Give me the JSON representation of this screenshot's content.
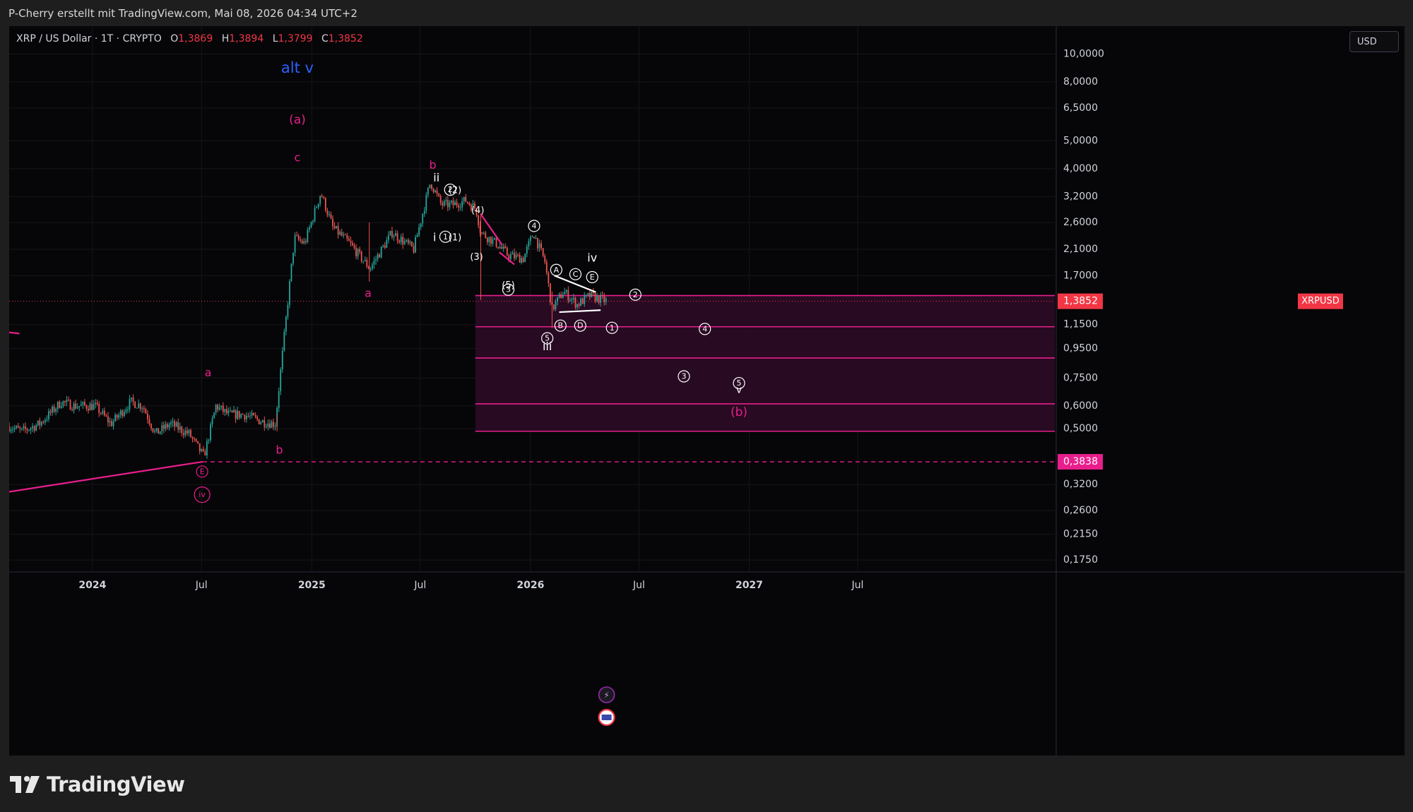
{
  "caption": "P-Cherry erstellt mit TradingView.com, Mai 08, 2026 04:34 UTC+2",
  "symbol": "XRP / US Dollar · 1T · CRYPTO",
  "ohlc": {
    "o_label": "O",
    "o": "1,3869",
    "h_label": "H",
    "h": "1,3894",
    "l_label": "L",
    "l": "1,3799",
    "c_label": "C",
    "c": "1,3852"
  },
  "currency": "USD",
  "brand": "TradingView",
  "colors": {
    "up": "#26a69a",
    "down": "#ef5350",
    "pink": "#e91e8c",
    "zone": "#2a0b24",
    "grid": "#16161a",
    "last_price": "#f23645",
    "blue": "#2962ff"
  },
  "price_badges": {
    "xrpusd_label": "XRPUSD",
    "last_price": "1,3852",
    "level_price": "0,3838"
  },
  "chart_data": {
    "type": "candlestick",
    "scale": "log",
    "ylim": [
      0.16,
      12.5
    ],
    "xlim": [
      "2023-08-15",
      "2028-05-25"
    ],
    "y_ticks": [
      {
        "v": 10.0,
        "label": "10,0000"
      },
      {
        "v": 8.0,
        "label": "8,0000"
      },
      {
        "v": 6.5,
        "label": "6,5000"
      },
      {
        "v": 5.0,
        "label": "5,0000"
      },
      {
        "v": 4.0,
        "label": "4,0000"
      },
      {
        "v": 3.2,
        "label": "3,2000"
      },
      {
        "v": 2.6,
        "label": "2,6000"
      },
      {
        "v": 2.1,
        "label": "2,1000"
      },
      {
        "v": 1.7,
        "label": "1,7000"
      },
      {
        "v": 1.15,
        "label": "1,1500"
      },
      {
        "v": 0.95,
        "label": "0,9500"
      },
      {
        "v": 0.75,
        "label": "0,7500"
      },
      {
        "v": 0.6,
        "label": "0,6000"
      },
      {
        "v": 0.5,
        "label": "0,5000"
      },
      {
        "v": 0.32,
        "label": "0,3200"
      },
      {
        "v": 0.26,
        "label": "0,2600"
      },
      {
        "v": 0.215,
        "label": "0,2150"
      },
      {
        "v": 0.175,
        "label": "0,1750"
      }
    ],
    "x_ticks": [
      {
        "d": "2024-01-01",
        "label": "2024",
        "bold": true
      },
      {
        "d": "2024-07-01",
        "label": "Jul",
        "bold": false
      },
      {
        "d": "2025-01-01",
        "label": "2025",
        "bold": true
      },
      {
        "d": "2025-07-01",
        "label": "Jul",
        "bold": false
      },
      {
        "d": "2026-01-01",
        "label": "2026",
        "bold": true
      },
      {
        "d": "2026-07-01",
        "label": "Jul",
        "bold": false
      },
      {
        "d": "2027-01-01",
        "label": "2027",
        "bold": true
      },
      {
        "d": "2027-07-01",
        "label": "Jul",
        "bold": false
      }
    ],
    "price_path": [
      [
        "2023-08-15",
        0.51
      ],
      [
        "2023-09-05",
        0.49
      ],
      [
        "2023-10-05",
        0.52
      ],
      [
        "2023-11-10",
        0.62
      ],
      [
        "2023-12-01",
        0.6
      ],
      [
        "2024-01-05",
        0.6
      ],
      [
        "2024-02-01",
        0.52
      ],
      [
        "2024-03-05",
        0.62
      ],
      [
        "2024-03-25",
        0.6
      ],
      [
        "2024-04-15",
        0.48
      ],
      [
        "2024-05-10",
        0.52
      ],
      [
        "2024-06-10",
        0.48
      ],
      [
        "2024-07-05",
        0.4
      ],
      [
        "2024-07-25",
        0.6
      ],
      [
        "2024-08-15",
        0.56
      ],
      [
        "2024-09-10",
        0.56
      ],
      [
        "2024-10-10",
        0.53
      ],
      [
        "2024-11-01",
        0.52
      ],
      [
        "2024-11-15",
        1.0
      ],
      [
        "2024-12-03",
        2.3
      ],
      [
        "2024-12-20",
        2.2
      ],
      [
        "2025-01-16",
        3.3
      ],
      [
        "2025-02-05",
        2.5
      ],
      [
        "2025-03-05",
        2.2
      ],
      [
        "2025-04-08",
        1.8
      ],
      [
        "2025-05-15",
        2.4
      ],
      [
        "2025-06-20",
        2.1
      ],
      [
        "2025-07-18",
        3.6
      ],
      [
        "2025-08-05",
        3.0
      ],
      [
        "2025-08-25",
        3.0
      ],
      [
        "2025-09-15",
        3.1
      ],
      [
        "2025-10-02",
        2.9
      ],
      [
        "2025-10-10",
        2.4
      ],
      [
        "2025-11-05",
        2.2
      ],
      [
        "2025-11-25",
        2.0
      ],
      [
        "2025-12-20",
        1.95
      ],
      [
        "2026-01-06",
        2.4
      ],
      [
        "2026-01-25",
        1.9
      ],
      [
        "2026-02-06",
        1.3
      ],
      [
        "2026-02-25",
        1.5
      ],
      [
        "2026-03-20",
        1.35
      ],
      [
        "2026-04-10",
        1.45
      ],
      [
        "2026-05-08",
        1.3852
      ]
    ],
    "zones": [
      {
        "from": "2025-10-01",
        "to": "2028-05-25",
        "top": 1.45,
        "bottom": 0.49
      }
    ],
    "levels": [
      1.45,
      1.13,
      0.88,
      0.61,
      0.49
    ],
    "dashed_level": 0.3838,
    "last_price": 1.3852
  },
  "labels": [
    {
      "text": "alt v",
      "d": "2024-12-08",
      "v": 8.9,
      "color": "#2962ff",
      "size": 21
    },
    {
      "text": "(a)",
      "d": "2024-12-08",
      "v": 5.9,
      "color": "#e91e8c",
      "size": 17
    },
    {
      "text": "c",
      "d": "2024-12-08",
      "v": 4.35,
      "color": "#e91e8c",
      "size": 16
    },
    {
      "text": "b",
      "d": "2025-07-22",
      "v": 4.1,
      "color": "#e91e8c",
      "size": 16
    },
    {
      "text": "ii",
      "d": "2025-07-28",
      "v": 3.7,
      "color": "#ffffff",
      "size": 16
    },
    {
      "text": "i",
      "d": "2025-07-25",
      "v": 2.3,
      "color": "#ffffff",
      "size": 16
    },
    {
      "text": "a",
      "d": "2025-04-05",
      "v": 1.47,
      "color": "#e91e8c",
      "size": 16
    },
    {
      "text": "a",
      "d": "2024-07-12",
      "v": 0.78,
      "color": "#e91e8c",
      "size": 16
    },
    {
      "text": "b",
      "d": "2024-11-08",
      "v": 0.42,
      "color": "#e91e8c",
      "size": 16
    },
    {
      "text": "(2)",
      "d": "2025-08-28",
      "v": 3.35,
      "color": "#ffffff",
      "size": 13
    },
    {
      "text": "(1)",
      "d": "2025-08-28",
      "v": 2.3,
      "color": "#ffffff",
      "size": 13
    },
    {
      "text": "(4)",
      "d": "2025-10-05",
      "v": 2.86,
      "color": "#ffffff",
      "size": 13
    },
    {
      "text": "(3)",
      "d": "2025-10-03",
      "v": 1.97,
      "color": "#ffffff",
      "size": 13
    },
    {
      "text": "(5)",
      "d": "2025-11-25",
      "v": 1.57,
      "color": "#ffffff",
      "size": 13
    },
    {
      "text": "iii",
      "d": "2026-01-29",
      "v": 0.96,
      "color": "#ffffff",
      "size": 16
    },
    {
      "text": "iv",
      "d": "2026-04-14",
      "v": 1.95,
      "color": "#ffffff",
      "size": 16
    },
    {
      "text": "v",
      "d": "2026-12-15",
      "v": 0.68,
      "color": "#ffffff",
      "size": 14
    },
    {
      "text": "(b)",
      "d": "2026-12-15",
      "v": 0.57,
      "color": "#e91e8c",
      "size": 17
    }
  ],
  "circle_labels": [
    {
      "text": "2",
      "d": "2025-08-20",
      "v": 3.38,
      "color": "#ffffff"
    },
    {
      "text": "1",
      "d": "2025-08-12",
      "v": 2.32,
      "color": "#ffffff"
    },
    {
      "text": "4",
      "d": "2026-01-07",
      "v": 2.53,
      "color": "#ffffff"
    },
    {
      "text": "3",
      "d": "2025-11-25",
      "v": 1.52,
      "color": "#ffffff"
    },
    {
      "text": "A",
      "d": "2026-02-13",
      "v": 1.78,
      "color": "#ffffff"
    },
    {
      "text": "C",
      "d": "2026-03-17",
      "v": 1.72,
      "color": "#ffffff"
    },
    {
      "text": "E",
      "d": "2026-04-14",
      "v": 1.68,
      "color": "#ffffff"
    },
    {
      "text": "B",
      "d": "2026-02-20",
      "v": 1.14,
      "color": "#ffffff"
    },
    {
      "text": "D",
      "d": "2026-03-25",
      "v": 1.14,
      "color": "#ffffff"
    },
    {
      "text": "5",
      "d": "2026-01-29",
      "v": 1.03,
      "color": "#ffffff"
    },
    {
      "text": "2",
      "d": "2026-06-25",
      "v": 1.46,
      "color": "#ffffff"
    },
    {
      "text": "1",
      "d": "2026-05-17",
      "v": 1.12,
      "color": "#ffffff"
    },
    {
      "text": "4",
      "d": "2026-10-19",
      "v": 1.11,
      "color": "#ffffff"
    },
    {
      "text": "3",
      "d": "2026-09-14",
      "v": 0.76,
      "color": "#ffffff"
    },
    {
      "text": "5",
      "d": "2026-12-15",
      "v": 0.72,
      "color": "#ffffff"
    },
    {
      "text": "E",
      "d": "2024-07-02",
      "v": 0.355,
      "color": "#e91e8c"
    },
    {
      "text": "iv",
      "d": "2024-07-02",
      "v": 0.295,
      "color": "#e91e8c"
    }
  ],
  "lines": [
    {
      "from": [
        "2023-08-15",
        0.302
      ],
      "to": [
        "2024-07-03",
        0.384
      ],
      "color": "#e91e8c",
      "width": 2.2
    },
    {
      "from": [
        "2023-08-15",
        1.08
      ],
      "to": [
        "2023-09-01",
        1.07
      ],
      "color": "#e91e8c",
      "width": 2.2
    },
    {
      "from": [
        "2025-10-10",
        2.78
      ],
      "to": [
        "2025-11-15",
        2.17
      ],
      "color": "#e91e8c",
      "width": 2.2
    },
    {
      "from": [
        "2025-11-10",
        2.05
      ],
      "to": [
        "2025-12-05",
        1.86
      ],
      "color": "#e91e8c",
      "width": 2.2
    },
    {
      "from": [
        "2026-02-10",
        1.7
      ],
      "to": [
        "2026-04-20",
        1.49
      ],
      "color": "#ffffff",
      "width": 2.2
    },
    {
      "from": [
        "2026-02-18",
        1.27
      ],
      "to": [
        "2026-04-28",
        1.29
      ],
      "color": "#ffffff",
      "width": 2.2
    }
  ]
}
